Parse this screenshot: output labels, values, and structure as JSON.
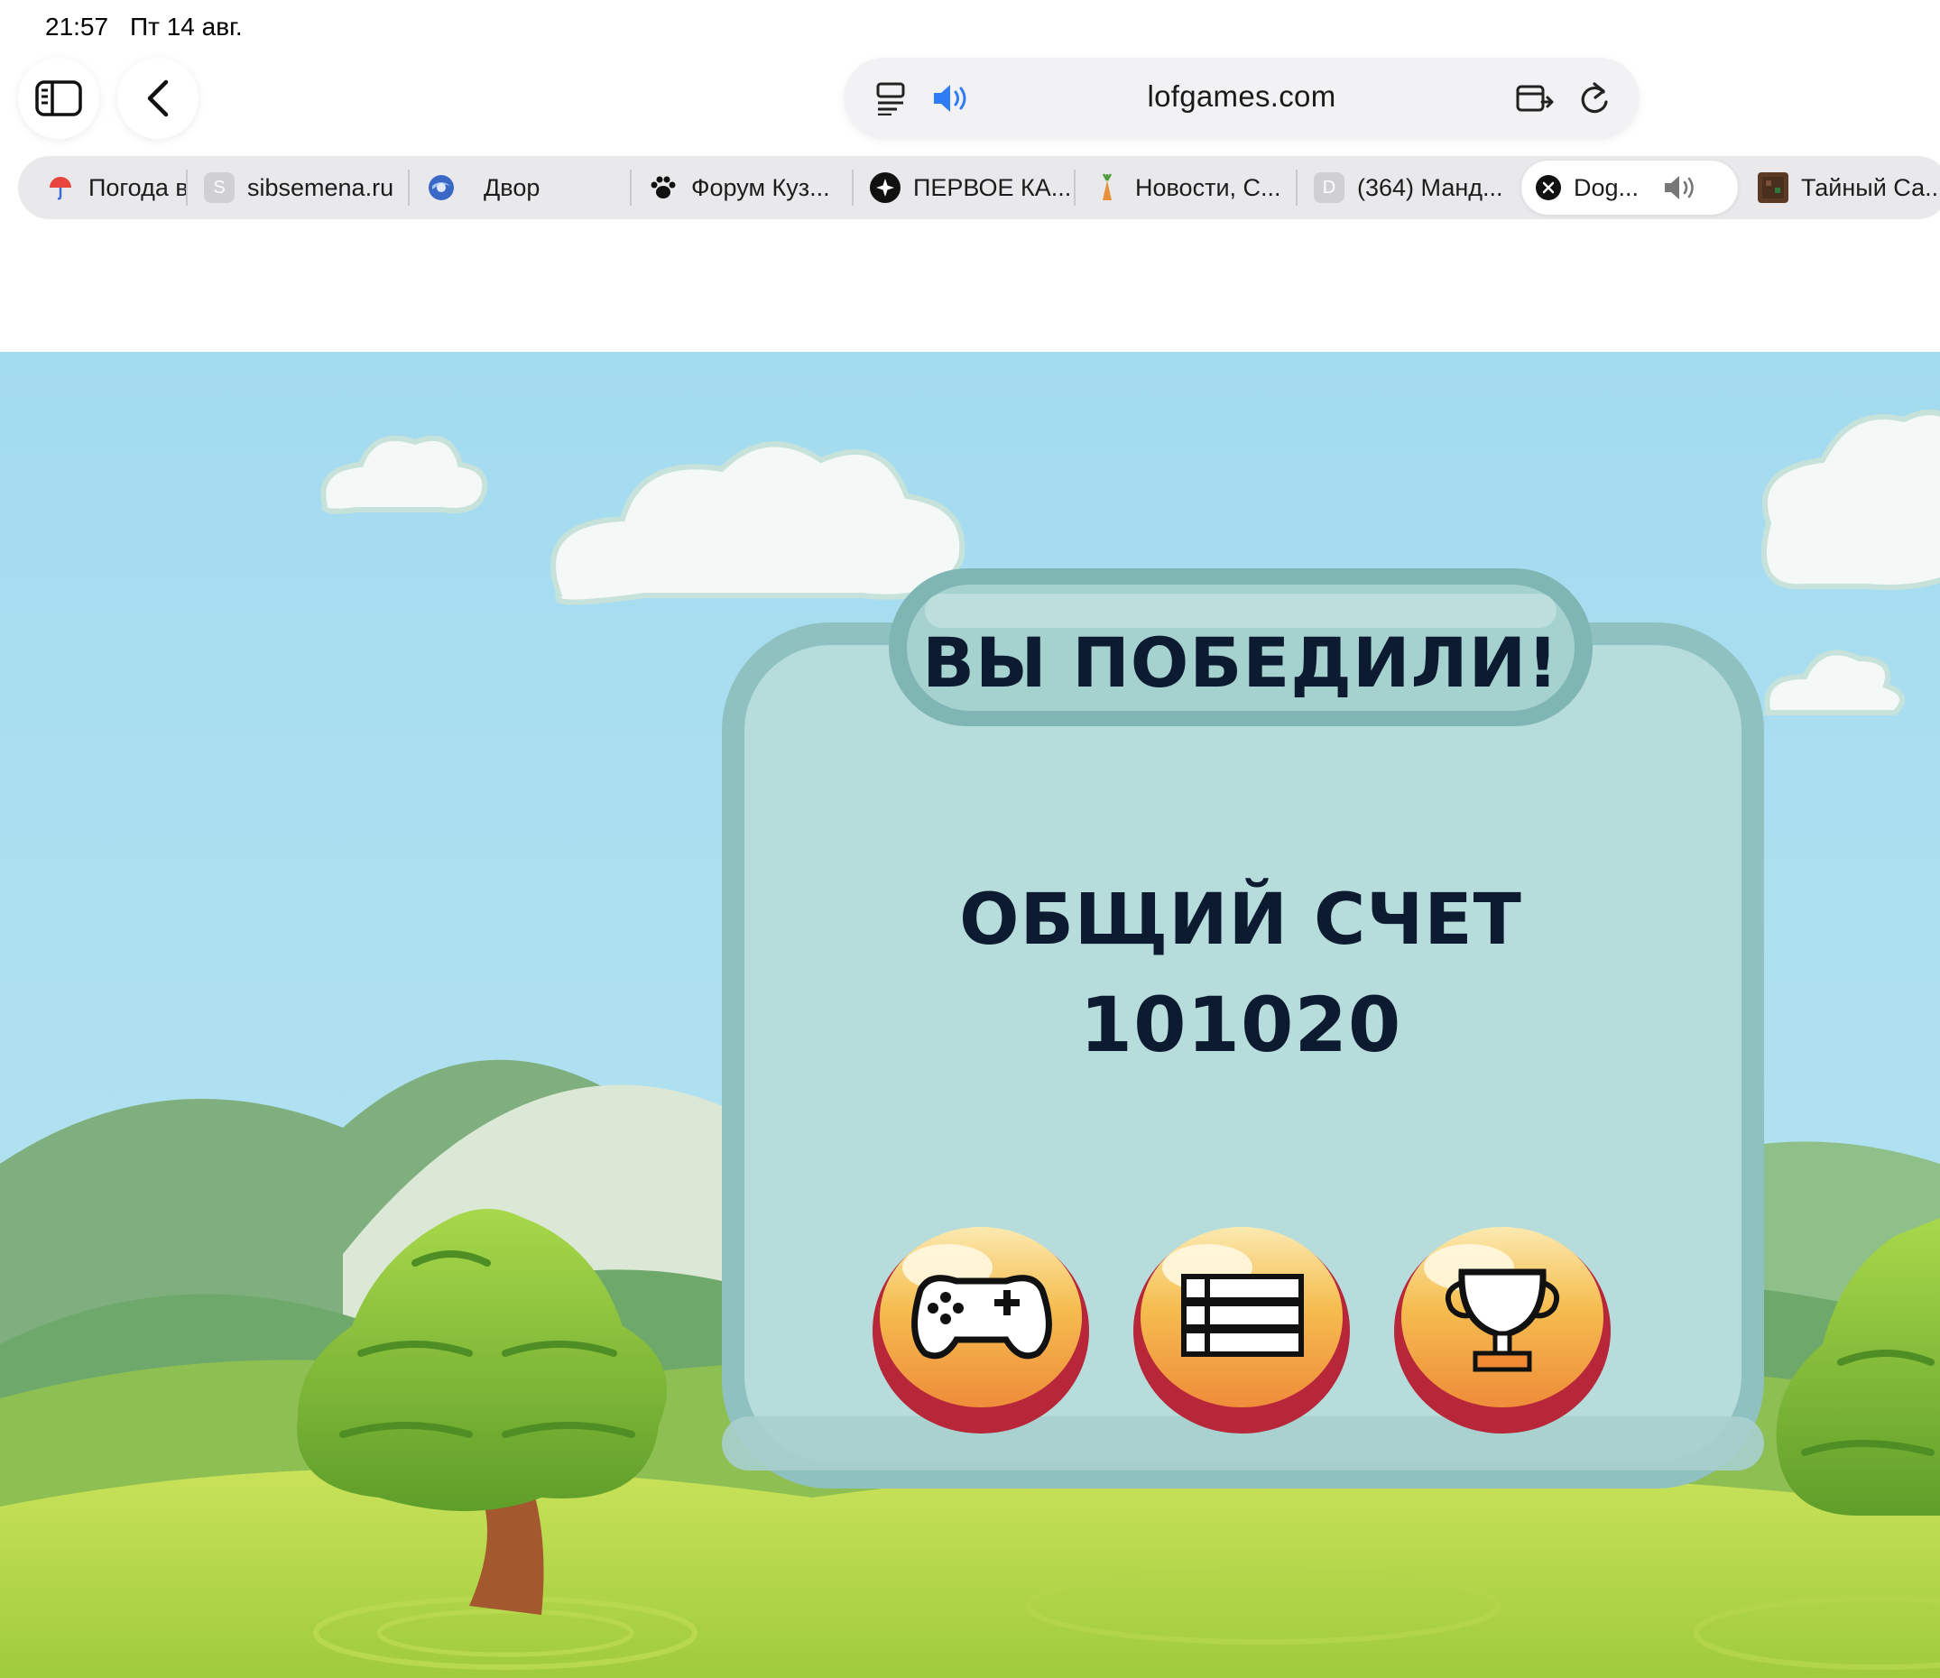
{
  "status_bar": {
    "time": "21:57",
    "date": "Пт 14 авг."
  },
  "toolbar": {
    "sidebar_icon": "sidebar-icon",
    "back_icon": "chevron-left-icon",
    "url": "lofgames.com",
    "reader_icon": "reader-mode-icon",
    "audio_icon": "speaker-icon",
    "share_icon": "tab-share-icon",
    "reload_icon": "reload-icon",
    "accent_color": "#2f7cf6"
  },
  "tabs": [
    {
      "label": "Погода в",
      "favicon": "umbrella-icon"
    },
    {
      "label": "sibsemena.ru",
      "favicon": "S"
    },
    {
      "label": "Двор",
      "favicon": "globe-icon"
    },
    {
      "label": "Форум Куз...",
      "favicon": "paw-icon"
    },
    {
      "label": "ПЕРВОЕ КА...",
      "favicon": "star-icon"
    },
    {
      "label": "Новости, С...",
      "favicon": "carrot-icon"
    },
    {
      "label": "(364) Манд...",
      "favicon": "D"
    },
    {
      "label": "Dog...",
      "favicon": "close-icon",
      "active": true,
      "audio": true
    },
    {
      "label": "Тайный Са...",
      "favicon": "box-icon"
    }
  ],
  "game": {
    "title": "ВЫ ПОБЕДИЛИ!",
    "score_label": "ОБЩИЙ СЧЕТ",
    "score_value": "101020",
    "buttons": [
      {
        "name": "play-again",
        "icon": "gamepad-icon"
      },
      {
        "name": "menu",
        "icon": "list-icon"
      },
      {
        "name": "leaderboard",
        "icon": "trophy-icon"
      }
    ],
    "colors": {
      "sky": "#a6dcf0",
      "panel": "#b5dcdc",
      "panel_frame": "#8abcbb",
      "button": "#f3b33f",
      "button_rim": "#b8263a"
    }
  }
}
